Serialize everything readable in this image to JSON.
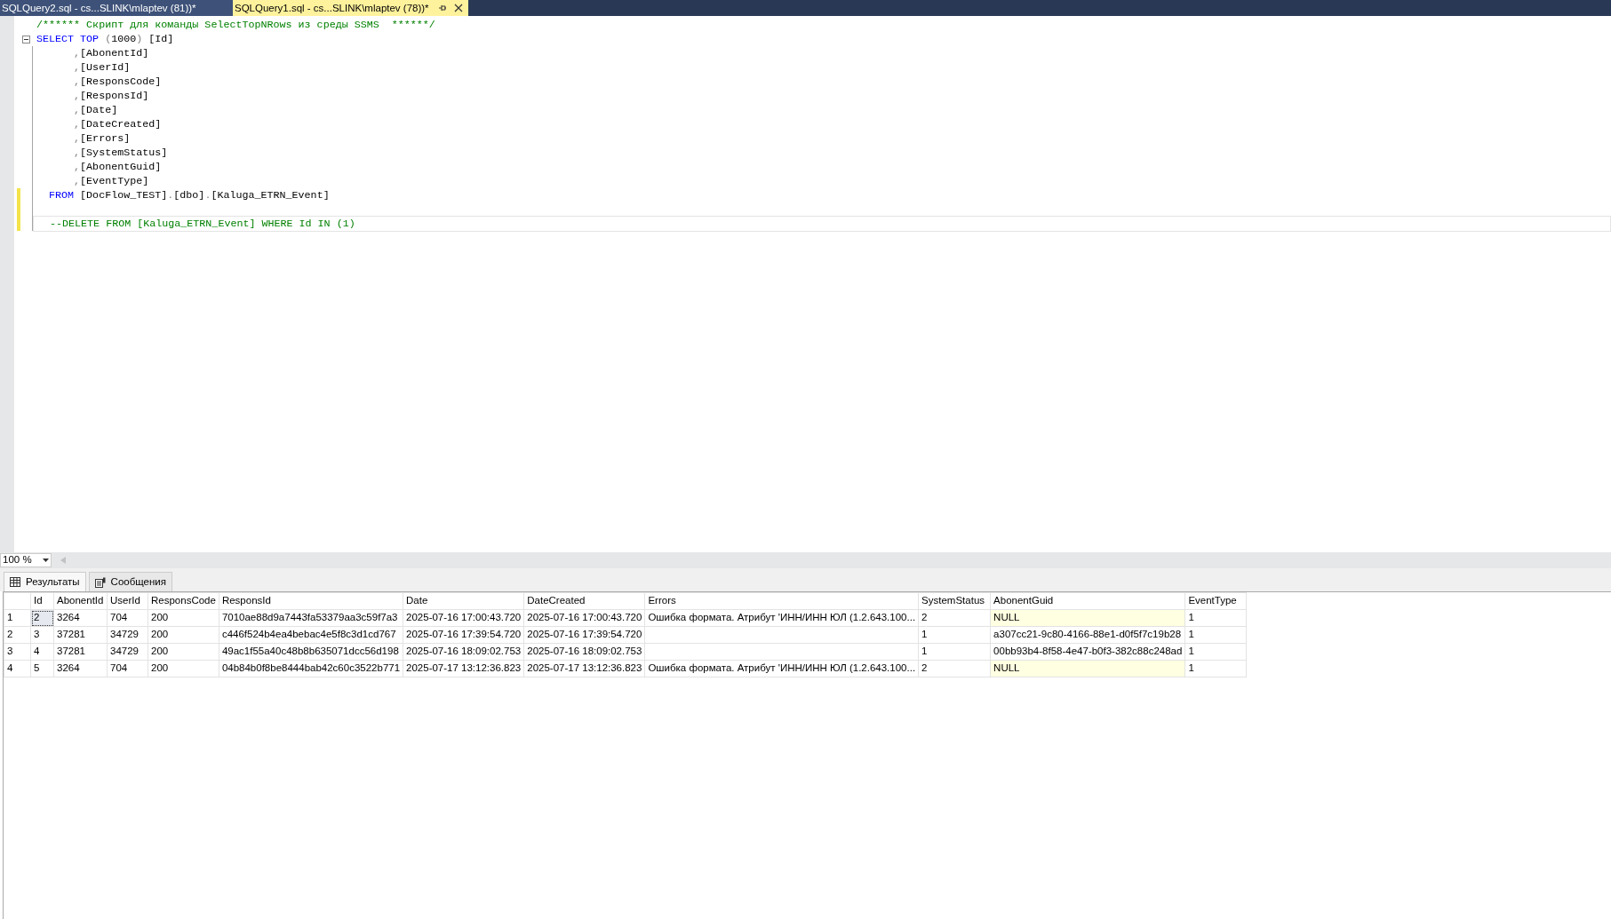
{
  "tabs": [
    {
      "label": "SQLQuery2.sql - cs...SLINK\\mlaptev (81))*",
      "selected": false
    },
    {
      "label": "SQLQuery1.sql - cs...SLINK\\mlaptev (78))*",
      "selected": true
    }
  ],
  "editor": {
    "lines": [
      {
        "kind": "statement",
        "tokens": [
          {
            "kind": "comment",
            "text": "/****** Скрипт для команды SelectTopNRows из среды SSMS  ******/"
          }
        ]
      },
      {
        "kind": "statement",
        "fold": true,
        "tokens": [
          {
            "kind": "keyword",
            "text": "SELECT TOP "
          },
          {
            "kind": "gray",
            "text": "("
          },
          {
            "kind": "text",
            "text": "1000"
          },
          {
            "kind": "gray",
            "text": ")"
          },
          {
            "kind": "text",
            "text": " [Id]"
          }
        ]
      },
      {
        "kind": "column",
        "tokens": [
          {
            "kind": "gray",
            "text": ","
          },
          {
            "kind": "text",
            "text": "[AbonentId]"
          }
        ]
      },
      {
        "kind": "column",
        "tokens": [
          {
            "kind": "gray",
            "text": ","
          },
          {
            "kind": "text",
            "text": "[UserId]"
          }
        ]
      },
      {
        "kind": "column",
        "tokens": [
          {
            "kind": "gray",
            "text": ","
          },
          {
            "kind": "text",
            "text": "[ResponsCode]"
          }
        ]
      },
      {
        "kind": "column",
        "tokens": [
          {
            "kind": "gray",
            "text": ","
          },
          {
            "kind": "text",
            "text": "[ResponsId]"
          }
        ]
      },
      {
        "kind": "column",
        "tokens": [
          {
            "kind": "gray",
            "text": ","
          },
          {
            "kind": "text",
            "text": "[Date]"
          }
        ]
      },
      {
        "kind": "column",
        "tokens": [
          {
            "kind": "gray",
            "text": ","
          },
          {
            "kind": "text",
            "text": "[DateCreated]"
          }
        ]
      },
      {
        "kind": "column",
        "tokens": [
          {
            "kind": "gray",
            "text": ","
          },
          {
            "kind": "text",
            "text": "[Errors]"
          }
        ]
      },
      {
        "kind": "column",
        "tokens": [
          {
            "kind": "gray",
            "text": ","
          },
          {
            "kind": "text",
            "text": "[SystemStatus]"
          }
        ]
      },
      {
        "kind": "column",
        "tokens": [
          {
            "kind": "gray",
            "text": ","
          },
          {
            "kind": "text",
            "text": "[AbonentGuid]"
          }
        ]
      },
      {
        "kind": "column",
        "tokens": [
          {
            "kind": "gray",
            "text": ","
          },
          {
            "kind": "text",
            "text": "[EventType]"
          }
        ]
      },
      {
        "kind": "clause",
        "changed": true,
        "tokens": [
          {
            "kind": "keyword",
            "text": "FROM"
          },
          {
            "kind": "text",
            "text": " [DocFlow_TEST]"
          },
          {
            "kind": "gray",
            "text": "."
          },
          {
            "kind": "text",
            "text": "[dbo]"
          },
          {
            "kind": "gray",
            "text": "."
          },
          {
            "kind": "text",
            "text": "[Kaluga_ETRN_Event]"
          }
        ]
      },
      {
        "kind": "clause",
        "changed": true
      },
      {
        "kind": "clause",
        "changed": true,
        "current": true,
        "tokens": [
          {
            "kind": "comment",
            "text": "--DELETE FROM [Kaluga_ETRN_Event] WHERE Id IN (1)"
          }
        ]
      }
    ]
  },
  "zoom": "100 %",
  "result_tabs": [
    {
      "label": "Результаты",
      "kind": "grid",
      "selected": true
    },
    {
      "label": "Сообщения",
      "kind": "messages",
      "selected": false
    }
  ],
  "grid": {
    "columns": [
      "Id",
      "AbonentId",
      "UserId",
      "ResponsCode",
      "ResponsId",
      "Date",
      "DateCreated",
      "Errors",
      "SystemStatus",
      "AbonentGuid",
      "EventType"
    ],
    "rows": [
      {
        "number": "1",
        "cells": [
          {
            "text": "2",
            "focused": true
          },
          {
            "text": "3264"
          },
          {
            "text": "704"
          },
          {
            "text": "200"
          },
          {
            "text": "7010ae88d9a7443fa53379aa3c59f7a3"
          },
          {
            "text": "2025-07-16 17:00:43.720"
          },
          {
            "text": "2025-07-16 17:00:43.720"
          },
          {
            "text": "Ошибка формата. Атрибут 'ИНН/ИНН ЮЛ (1.2.643.100..."
          },
          {
            "text": "2"
          },
          {
            "text": "NULL",
            "null": true
          },
          {
            "text": "1"
          }
        ]
      },
      {
        "number": "2",
        "cells": [
          {
            "text": "3"
          },
          {
            "text": "37281"
          },
          {
            "text": "34729"
          },
          {
            "text": "200"
          },
          {
            "text": "c446f524b4ea4bebac4e5f8c3d1cd767"
          },
          {
            "text": "2025-07-16 17:39:54.720"
          },
          {
            "text": "2025-07-16 17:39:54.720"
          },
          {},
          {
            "text": "1"
          },
          {
            "text": "a307cc21-9c80-4166-88e1-d0f5f7c19b28"
          },
          {
            "text": "1"
          }
        ]
      },
      {
        "number": "3",
        "cells": [
          {
            "text": "4"
          },
          {
            "text": "37281"
          },
          {
            "text": "34729"
          },
          {
            "text": "200"
          },
          {
            "text": "49ac1f55a40c48b8b635071dcc56d198"
          },
          {
            "text": "2025-07-16 18:09:02.753"
          },
          {
            "text": "2025-07-16 18:09:02.753"
          },
          {},
          {
            "text": "1"
          },
          {
            "text": "00bb93b4-8f58-4e47-b0f3-382c88c248ad"
          },
          {
            "text": "1"
          }
        ]
      },
      {
        "number": "4",
        "cells": [
          {
            "text": "5"
          },
          {
            "text": "3264"
          },
          {
            "text": "704"
          },
          {
            "text": "200"
          },
          {
            "text": "04b84b0f8be8444bab42c60c3522b771"
          },
          {
            "text": "2025-07-17 13:12:36.823"
          },
          {
            "text": "2025-07-17 13:12:36.823"
          },
          {
            "text": "Ошибка формата. Атрибут 'ИНН/ИНН ЮЛ (1.2.643.100..."
          },
          {
            "text": "2"
          },
          {
            "text": "NULL",
            "null": true
          },
          {
            "text": "1"
          }
        ]
      }
    ]
  }
}
